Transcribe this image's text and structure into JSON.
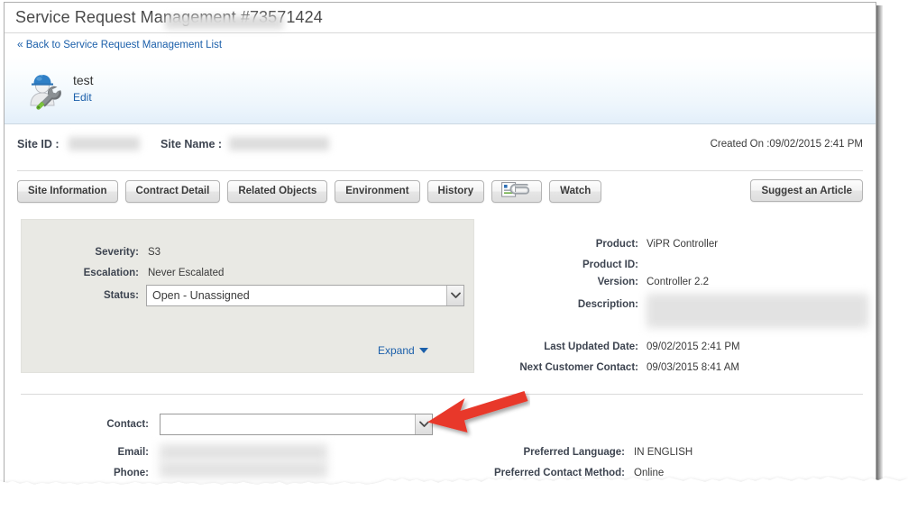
{
  "window": {
    "title": "Service Request Management #73571424"
  },
  "back_link": {
    "chevron": "«",
    "label": "Back to Service Request Management List"
  },
  "identity": {
    "icon": "service-request-worker-icon",
    "name": "test",
    "edit_label": "Edit"
  },
  "site": {
    "site_id_label": "Site ID :",
    "site_id_value": "",
    "site_name_label": "Site Name :",
    "site_name_value": "",
    "created_on": "Created On :09/02/2015 2:41 PM"
  },
  "tabs": [
    {
      "label": "Site Information",
      "name": "tab-site-information"
    },
    {
      "label": "Contract Detail",
      "name": "tab-contract-detail"
    },
    {
      "label": "Related Objects",
      "name": "tab-related-objects"
    },
    {
      "label": "Environment",
      "name": "tab-environment"
    },
    {
      "label": "History",
      "name": "tab-history"
    }
  ],
  "attachment_button": {
    "icon": "attachment-paperclip-icon",
    "label": ""
  },
  "watch_button": {
    "label": "Watch"
  },
  "suggest_button": {
    "label": "Suggest an Article"
  },
  "case_details": {
    "severity_label": "Severity:",
    "severity_value": "S3",
    "escalation_label": "Escalation:",
    "escalation_value": "Never Escalated",
    "status_label": "Status:",
    "status_value": "Open - Unassigned",
    "status_options": [
      "Open - Unassigned"
    ],
    "expand_label": "Expand"
  },
  "product_details": {
    "product_label": "Product:",
    "product_value": "ViPR Controller",
    "product_id_label": "Product ID:",
    "product_id_value": "",
    "version_label": "Version:",
    "version_value": "Controller 2.2",
    "description_label": "Description:",
    "description_value": "",
    "last_updated_label": "Last Updated Date:",
    "last_updated_value": "09/02/2015 2:41 PM",
    "next_contact_label": "Next Customer Contact:",
    "next_contact_value": "09/03/2015 8:41 AM"
  },
  "contact_details": {
    "contact_label": "Contact:",
    "contact_value": "",
    "email_label": "Email:",
    "email_value": "",
    "phone_label": "Phone:",
    "phone_value": "",
    "preferred_language_label": "Preferred Language:",
    "preferred_language_value": "IN ENGLISH",
    "preferred_method_label": "Preferred Contact Method:",
    "preferred_method_value": "Online"
  },
  "annotation": {
    "arrow": "red-callout-arrow",
    "arrow_color": "#e8392c",
    "points_to": "contact-dropdown"
  },
  "colors": {
    "link": "#1b5faa",
    "panel_bg": "#e9e9e4",
    "band_top": "#ffffff",
    "band_bottom": "#e3effa",
    "text": "#3a3a3a",
    "label": "#3d4450"
  }
}
